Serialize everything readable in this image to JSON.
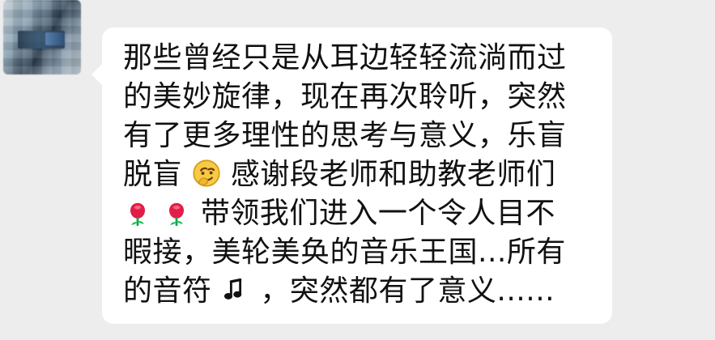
{
  "chat": {
    "sender_name": "",
    "message_lines": [
      [
        "那些曾经只是从耳边轻轻流淌而过"
      ],
      [
        "的美妙旋律，现在再次聆听，突然"
      ],
      [
        "有了更多理性的思考与意义，乐盲"
      ],
      [
        "脱盲",
        {
          "emoji": "thinking-face-icon"
        },
        "感谢段老师和助教老师们"
      ],
      [
        {
          "emoji": "rose-icon"
        },
        {
          "emoji": "rose-icon"
        },
        "带领我们进入一个令人目不"
      ],
      [
        "暇接，美轮美奂的音乐王国...所有"
      ],
      [
        "的音符",
        {
          "emoji": "music-notes-icon"
        },
        "，突然都有了意义......"
      ]
    ]
  }
}
